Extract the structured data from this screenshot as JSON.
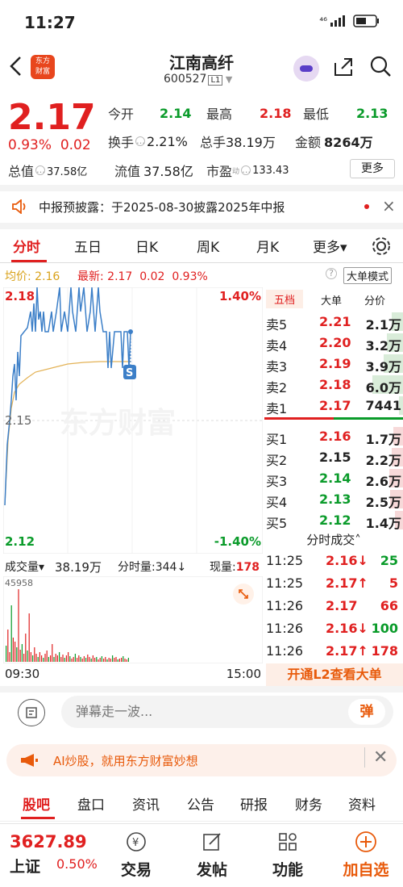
{
  "status_bar": {
    "time": "11:27",
    "indicators": "⁴⁶ ▮▮▮▮ ▭"
  },
  "header": {
    "logo_line1": "东方",
    "logo_line2": "财富",
    "stock_name": "江南高纤",
    "stock_code": "600527",
    "level_badge": "L1"
  },
  "quote": {
    "price": "2.17",
    "change_pct": "0.93%",
    "change_abs": "0.02",
    "open_label": "今开",
    "open": "2.14",
    "high_label": "最高",
    "high": "2.18",
    "low_label": "最低",
    "low": "2.13",
    "turnover_label": "换手",
    "turnover": "2.21%",
    "total_hands_label": "总手",
    "total_hands": "38.19万",
    "amount_label": "金额",
    "amount": "8264万",
    "mktcap_label": "总值",
    "mktcap": "37.58亿",
    "float_label": "流值",
    "float_cap": "37.58亿",
    "pe_label": "市盈",
    "pe_superscript": "动",
    "pe": "133.43",
    "more_label": "更多"
  },
  "notice": {
    "text": "中报预披露：于2025-08-30披露2025年中报"
  },
  "period_tabs": [
    "分时",
    "五日",
    "日K",
    "周K",
    "月K",
    "更多▾"
  ],
  "info_line": {
    "avg_label": "均价:",
    "avg": "2.16",
    "latest_label": "最新:",
    "latest": "2.17",
    "chg": "0.02",
    "pct": "0.93%",
    "big_order_mode": "大单模式"
  },
  "chart_labels": {
    "top_price": "2.18",
    "top_pct": "1.40%",
    "mid_price": "2.15",
    "bottom_price": "2.12",
    "bottom_pct": "-1.40%",
    "sell_marker": "S",
    "watermark": "东方财富"
  },
  "order_book": {
    "tabs": [
      "五档",
      "大单",
      "分价"
    ],
    "asks": [
      {
        "label": "卖5",
        "price": "2.21",
        "vol": "2.1万",
        "bar": 0.35
      },
      {
        "label": "卖4",
        "price": "2.20",
        "vol": "3.2万",
        "bar": 0.5
      },
      {
        "label": "卖3",
        "price": "2.19",
        "vol": "3.9万",
        "bar": 0.6
      },
      {
        "label": "卖2",
        "price": "2.18",
        "vol": "6.0万",
        "bar": 0.95
      },
      {
        "label": "卖1",
        "price": "2.17",
        "vol": "7441",
        "bar": 0.12
      }
    ],
    "bids": [
      {
        "label": "买1",
        "price": "2.16",
        "vol": "1.7万",
        "bar": 0.3
      },
      {
        "label": "买2",
        "price": "2.15",
        "vol": "2.2万",
        "bar": 0.35
      },
      {
        "label": "买3",
        "price": "2.14",
        "vol": "2.6万",
        "bar": 0.42
      },
      {
        "label": "买4",
        "price": "2.13",
        "vol": "2.5万",
        "bar": 0.4
      },
      {
        "label": "买5",
        "price": "2.12",
        "vol": "1.4万",
        "bar": 0.25
      }
    ]
  },
  "ticks": {
    "header": "分时成交˄",
    "rows": [
      {
        "time": "11:25",
        "price": "2.16↓",
        "vol": "25",
        "dir": "down"
      },
      {
        "time": "11:25",
        "price": "2.17↑",
        "vol": "5",
        "dir": "up"
      },
      {
        "time": "11:26",
        "price": "2.17",
        "vol": "66",
        "dir": "up"
      },
      {
        "time": "11:26",
        "price": "2.16↓",
        "vol": "100",
        "dir": "down"
      },
      {
        "time": "11:26",
        "price": "2.17↑",
        "vol": "178",
        "dir": "up"
      }
    ]
  },
  "volume": {
    "label": "成交量▾",
    "total": "38.19万",
    "ticks_label": "分时量:",
    "ticks_val": "344↓",
    "current_label": "现量:",
    "current_val": "178",
    "max_label": "45958"
  },
  "time_axis": {
    "start": "09:30",
    "end": "15:00"
  },
  "l2_button": "开通L2查看大单",
  "danmu": {
    "placeholder": "弹幕走一波...",
    "button": "弹"
  },
  "ai_banner": {
    "text": "AI炒股，就用东方财富妙想"
  },
  "info_tabs": [
    "股吧",
    "盘口",
    "资讯",
    "公告",
    "研报",
    "财务",
    "资料"
  ],
  "bottom_bar": {
    "index_value": "3627.89",
    "index_name": "上证",
    "index_change": "0.50%",
    "items": [
      "交易",
      "发帖",
      "功能",
      "加自选"
    ]
  },
  "colors": {
    "up": "#e02020",
    "down": "#0a9b2a",
    "accent": "#e85a0b"
  }
}
